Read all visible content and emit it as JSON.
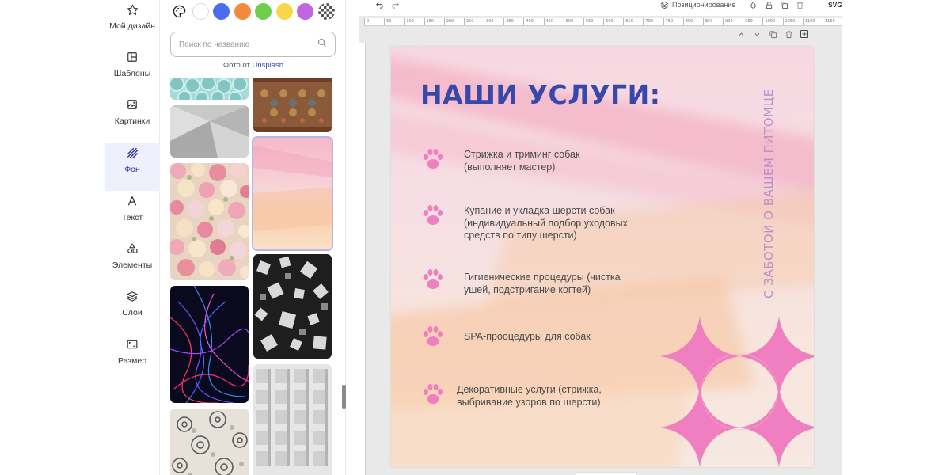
{
  "nav": {
    "items": [
      {
        "label": "Мой дизайн",
        "icon": "star-icon"
      },
      {
        "label": "Шаблоны",
        "icon": "template-icon"
      },
      {
        "label": "Картинки",
        "icon": "image-icon"
      },
      {
        "label": "Фон",
        "icon": "background-hatch-icon",
        "active": true
      },
      {
        "label": "Текст",
        "icon": "text-icon"
      },
      {
        "label": "Элементы",
        "icon": "shapes-icon"
      },
      {
        "label": "Слои",
        "icon": "layers-icon"
      },
      {
        "label": "Размер",
        "icon": "resize-icon"
      }
    ]
  },
  "panel": {
    "swatch_colors": [
      "#ffffff",
      "#4a6df0",
      "#f2893f",
      "#6fcf4c",
      "#f7d64a",
      "#c266e0"
    ],
    "search_placeholder": "Поиск по названию",
    "credit_prefix": "Фото от",
    "credit_link": "Unsplash",
    "tiles": [
      {
        "name": "turquoise-pearls"
      },
      {
        "name": "ornamental-carpet"
      },
      {
        "name": "gray-folded-paper"
      },
      {
        "name": "pink-watercolor",
        "selected": true
      },
      {
        "name": "flower-wall"
      },
      {
        "name": "black-white-cubes"
      },
      {
        "name": "neon-light-waves"
      },
      {
        "name": "white-grid-facade"
      },
      {
        "name": "floral-lace-pattern"
      }
    ]
  },
  "topbar": {
    "positioning_label": "Позиционирование",
    "export_label": "SVG"
  },
  "ruler_ticks": [
    "0",
    "50",
    "100",
    "150",
    "200",
    "250",
    "300",
    "350",
    "400",
    "450",
    "500",
    "550",
    "600",
    "650",
    "700",
    "750",
    "800",
    "850",
    "900",
    "950",
    "1000",
    "1050",
    "1100",
    "1150"
  ],
  "canvas": {
    "title": "НАШИ УСЛУГИ:",
    "vertical_text": "С ЗАБОТОЙ О ВАШЕМ ПИТОМЦЕ",
    "services": [
      {
        "lines": [
          "Стрижка и триминг собак",
          "(выполняет мастер)"
        ]
      },
      {
        "lines": [
          "Купание и укладка шерсти собак",
          "(индивидуальный подбор уходовых",
          "средств по типу шерсти)"
        ]
      },
      {
        "lines": [
          "Гигиенические процедуры (чистка",
          "ушей, подстригание когтей)"
        ]
      },
      {
        "lines": [
          "SPA-прооцедуры для собак"
        ]
      },
      {
        "lines": [
          "Декоративные услуги (стрижка,",
          "выбривание узоров по шерсти)"
        ]
      }
    ],
    "accent_color": "#ef7fc0",
    "title_color": "#3848a8"
  }
}
